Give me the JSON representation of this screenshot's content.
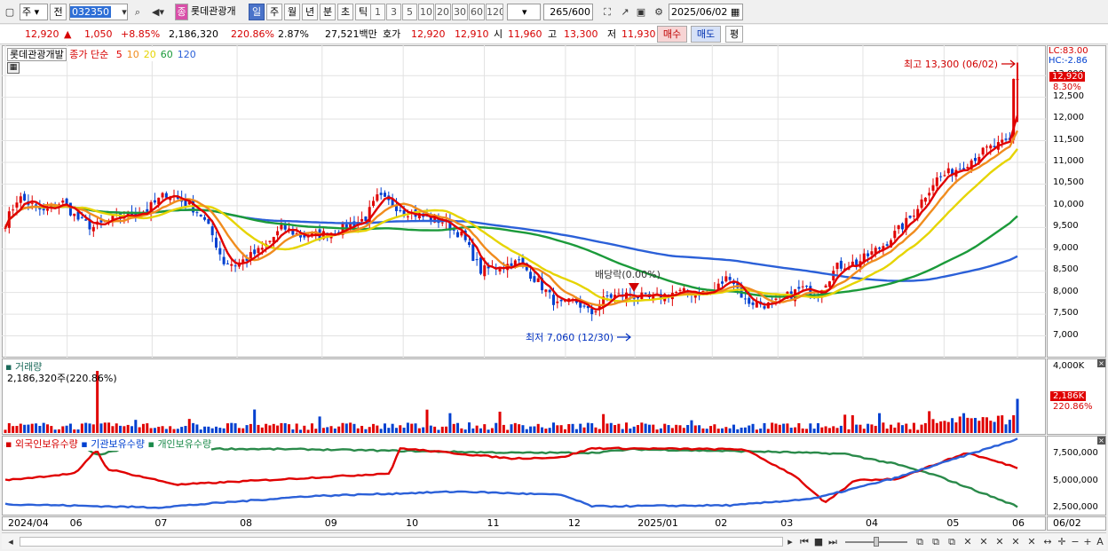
{
  "toolbar": {
    "type_select": "주",
    "prev_label": "전",
    "code": "032350",
    "stock_button": "종",
    "stock_name": "롯데관광개",
    "period_tabs": [
      {
        "label": "일",
        "active": true
      },
      {
        "label": "주",
        "active": false
      },
      {
        "label": "월",
        "active": false
      },
      {
        "label": "년",
        "active": false
      },
      {
        "label": "분",
        "active": false
      },
      {
        "label": "초",
        "active": false
      },
      {
        "label": "틱",
        "active": false
      }
    ],
    "intervals": [
      "1",
      "3",
      "5",
      "10",
      "20",
      "30",
      "60",
      "120"
    ],
    "count": "265",
    "count_total": "/600",
    "date": "2025/06/02"
  },
  "quote": {
    "price": "12,920",
    "arrow": "▲",
    "change": "1,050",
    "change_pct": "+8.85%",
    "volume": "2,186,320",
    "volume_ratio": "220.86%",
    "turnover": "2.87%",
    "amount": "27,521백만",
    "ask_label": "호가",
    "ask1": "12,920",
    "ask2": "12,910",
    "open_label": "시",
    "open": "11,960",
    "high_label": "고",
    "high": "13,300",
    "low_label": "저",
    "low": "11,930",
    "buy_label": "매수",
    "sell_label": "매도",
    "avg_label": "평"
  },
  "price_panel": {
    "legend_name": "롯데관광개발",
    "legend_ma_label": "종가 단순",
    "ma_periods": [
      {
        "label": "5",
        "color": "#e00000"
      },
      {
        "label": "10",
        "color": "#f08c1e"
      },
      {
        "label": "20",
        "color": "#e6d400"
      },
      {
        "label": "60",
        "color": "#1b9a3a"
      },
      {
        "label": "120",
        "color": "#2b60d8"
      }
    ],
    "lc": "LC:83.00",
    "hc": "HC:-2.86",
    "last_price": "12,920",
    "last_pct": "8.30%",
    "high_note": "최고 13,300 (06/02)",
    "low_note": "최저 7,060 (12/30)",
    "dividend_note": "배당락(0.00%)",
    "y_ticks": [
      "13,000",
      "12,500",
      "12,000",
      "11,500",
      "11,000",
      "10,500",
      "10,000",
      "9,500",
      "9,000",
      "8,500",
      "8,000",
      "7,500",
      "7,000"
    ]
  },
  "volume_panel": {
    "title": "거래량",
    "value": "2,186,320주(220.86%)",
    "y_tick": "4,000K",
    "last": "2,186K",
    "last_pct": "220.86%"
  },
  "holdings_panel": {
    "legend": [
      "외국인보유수량",
      "기관보유수량",
      "개인보유수량"
    ],
    "y_ticks": [
      "7,500,000",
      "5,000,000",
      "2,500,000"
    ]
  },
  "x_axis": [
    "2024/04",
    "06",
    "07",
    "08",
    "09",
    "10",
    "11",
    "12",
    "2025/01",
    "02",
    "03",
    "04",
    "05",
    "06"
  ],
  "x_axis_right": "06/02",
  "colors": {
    "up": "#e00000",
    "down": "#0040d0",
    "ma5": "#e00000",
    "ma10": "#f08c1e",
    "ma20": "#e6d400",
    "ma60": "#1b9a3a",
    "ma120": "#2b60d8"
  }
}
